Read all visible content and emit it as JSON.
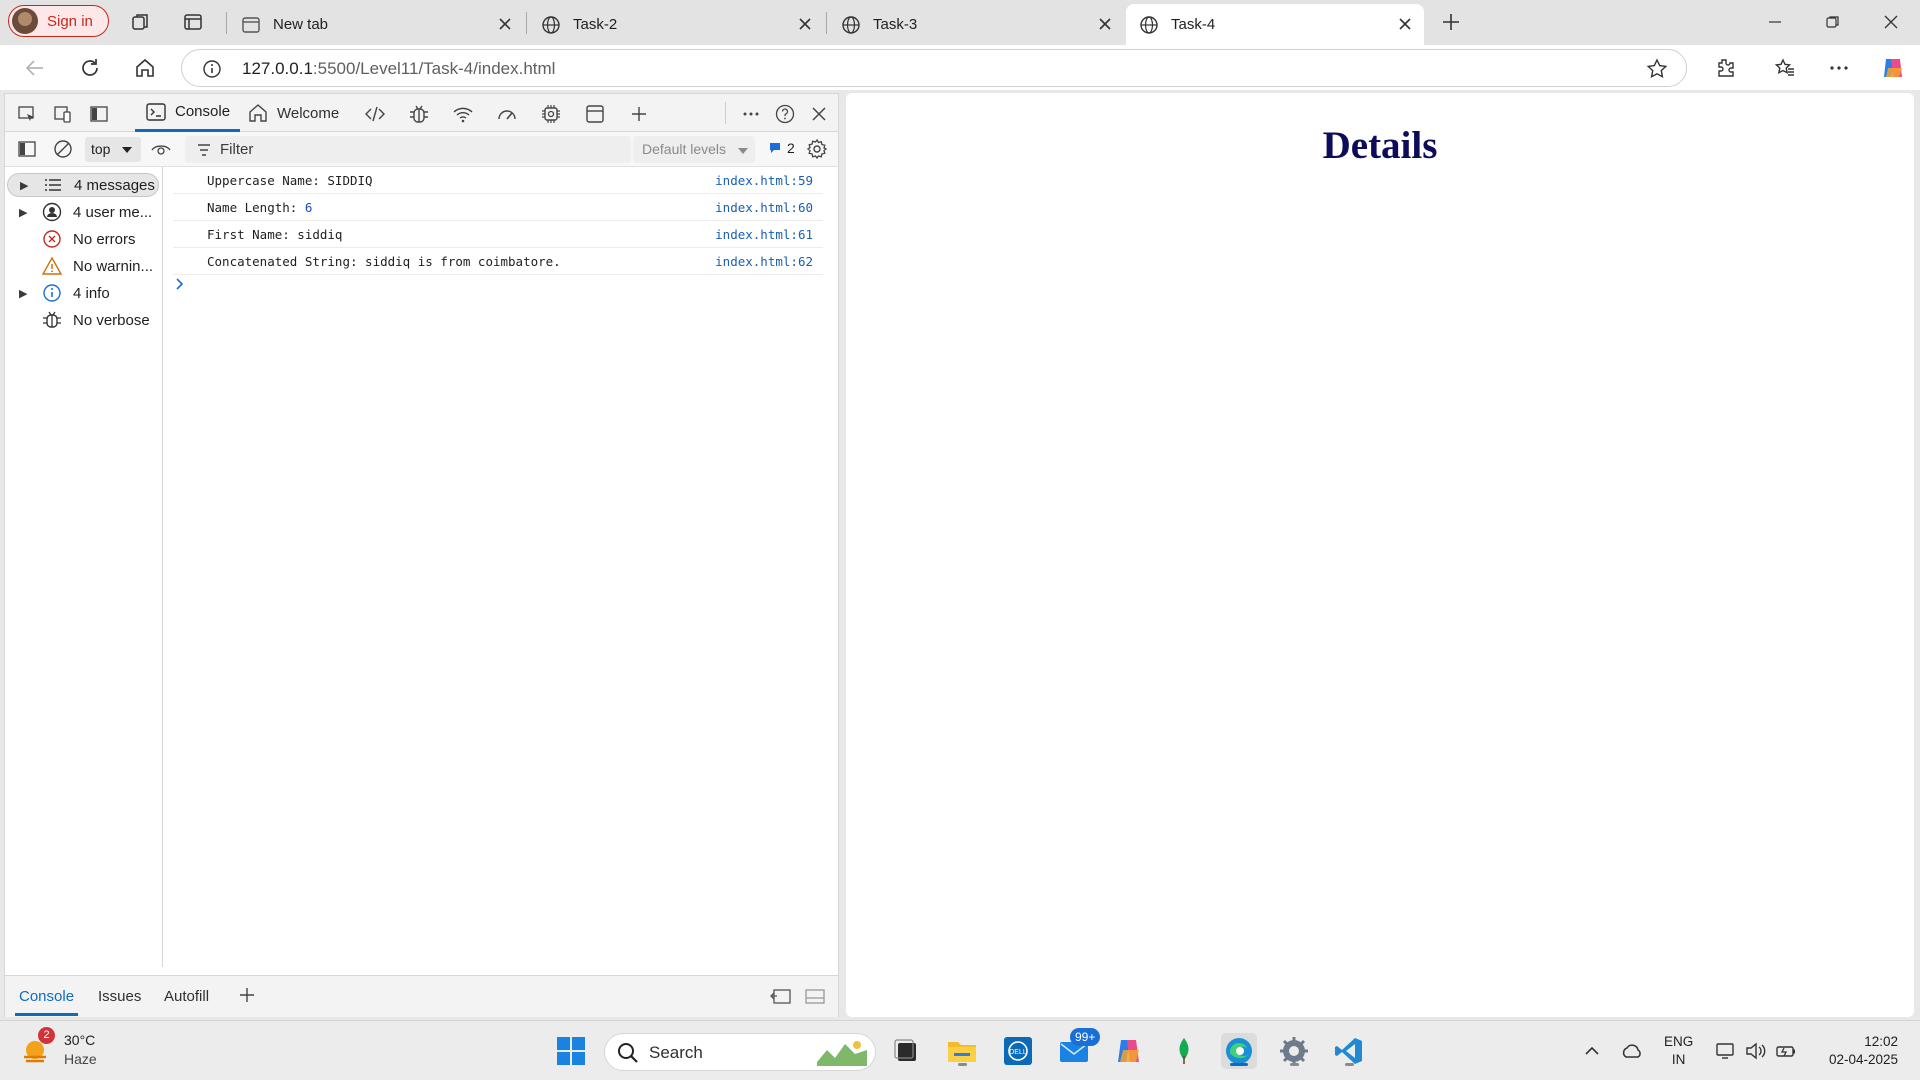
{
  "browser": {
    "signin_label": "Sign in",
    "tabs": [
      {
        "title": "New tab",
        "icon": "newtab-icon"
      },
      {
        "title": "Task-2",
        "icon": "globe-icon"
      },
      {
        "title": "Task-3",
        "icon": "globe-icon"
      },
      {
        "title": "Task-4",
        "icon": "globe-icon",
        "active": true
      }
    ],
    "url_host": "127.0.0.1",
    "url_rest": ":5500/Level11/Task-4/index.html",
    "accent": "#0f6cbd"
  },
  "devtools": {
    "tabs": {
      "console": "Console",
      "welcome": "Welcome"
    },
    "context": "top",
    "filter_placeholder": "Filter",
    "levels": "Default levels",
    "issues_count": "2",
    "sidebar": [
      {
        "label": "4 messages",
        "icon": "list-icon",
        "expandable": true,
        "selected": true
      },
      {
        "label": "4 user me...",
        "icon": "user-icon",
        "expandable": true
      },
      {
        "label": "No errors",
        "icon": "error-icon",
        "expandable": false
      },
      {
        "label": "No warnin...",
        "icon": "warning-icon",
        "expandable": false
      },
      {
        "label": "4 info",
        "icon": "info-icon",
        "expandable": true
      },
      {
        "label": "No verbose",
        "icon": "bug-icon",
        "expandable": false
      }
    ],
    "logs": [
      {
        "text": "Uppercase Name: SIDDIQ",
        "value": "",
        "source": "index.html:59"
      },
      {
        "text": "Name Length: ",
        "value": "6",
        "source": "index.html:60"
      },
      {
        "text": "First Name: siddiq",
        "value": "",
        "source": "index.html:61"
      },
      {
        "text": "Concatenated String: siddiq is from coimbatore.",
        "value": "",
        "source": "index.html:62"
      }
    ],
    "drawer_tabs": {
      "console": "Console",
      "issues": "Issues",
      "autofill": "Autofill"
    }
  },
  "page": {
    "heading": "Details"
  },
  "taskbar": {
    "weather_badge": "2",
    "temperature": "30°C",
    "condition": "Haze",
    "search_label": "Search",
    "mail_badge": "99+",
    "lang_top": "ENG",
    "lang_bottom": "IN",
    "time": "12:02",
    "date": "02-04-2025"
  }
}
